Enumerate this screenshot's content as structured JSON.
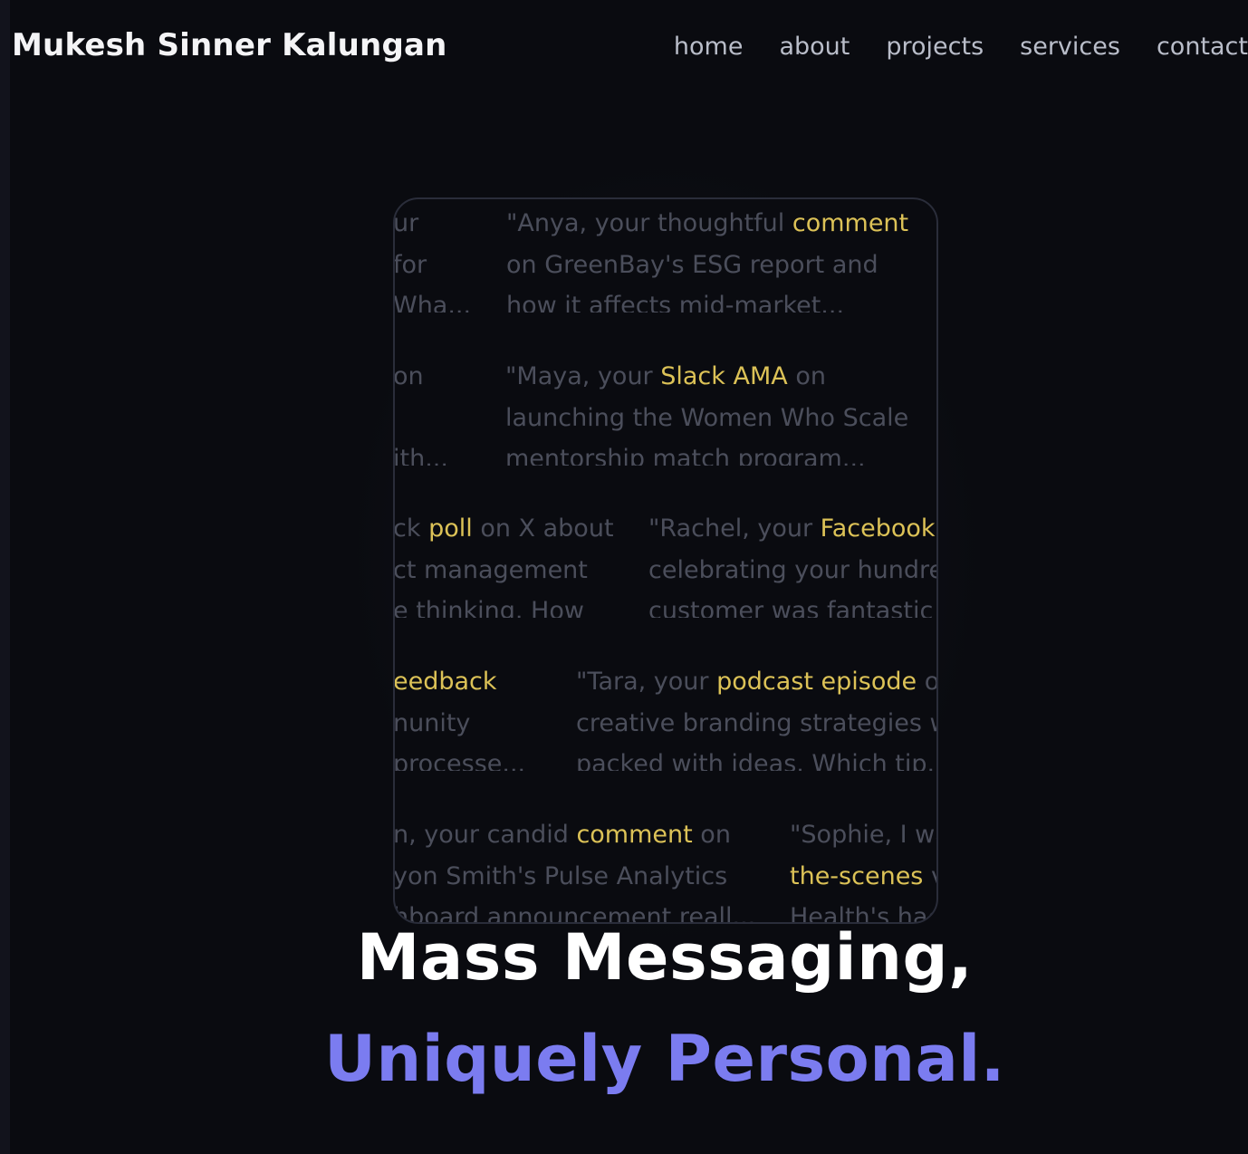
{
  "header": {
    "brand": "Mukesh Sinner Kalungan",
    "nav": [
      {
        "label": "home"
      },
      {
        "label": "about"
      },
      {
        "label": "projects"
      },
      {
        "label": "services"
      },
      {
        "label": "contact"
      }
    ]
  },
  "messages": {
    "m1": {
      "l1": "ur",
      "l2": "for",
      "l3": "Wha..."
    },
    "m2": {
      "l1_pre": "\"Anya, your thoughtful ",
      "l1_hl": "comment",
      "l2": "on GreenBay's ESG report and",
      "l3": "how it affects mid-market..."
    },
    "m3": {
      "l1": "on",
      "l3": "ith..."
    },
    "m4": {
      "l1_pre": "\"Maya, your ",
      "l1_hl": "Slack AMA",
      "l1_post": " on",
      "l2": "launching the Women Who Scale",
      "l3": "mentorship match program..."
    },
    "m5": {
      "l1_pre": "ck ",
      "l1_hl": "poll",
      "l1_post": " on X about",
      "l2": "ct management",
      "l3": "e thinking. How"
    },
    "m6": {
      "l1_pre": "\"Rachel, your ",
      "l1_hl": "Facebook p",
      "l2": "celebrating your hundred",
      "l3": "customer was fantastic"
    },
    "m7": {
      "l1_hl": "eedback",
      "l2": "nunity",
      "l3": "processe..."
    },
    "m8": {
      "l1_pre": "\"Tara, your ",
      "l1_hl": "podcast episode",
      "l1_post": " on",
      "l2": "creative branding strategies wa",
      "l3": "packed with ideas. Which tip..."
    },
    "m9": {
      "l1_pre": "n, your candid ",
      "l1_hl": "comment",
      "l1_post": " on",
      "l2": "yon Smith's Pulse Analytics",
      "l3": "hboard announcement reall..."
    },
    "m10": {
      "l1": "\"Sophie, I wa",
      "l2_hl": "the-scenes",
      "l2_post": " v",
      "l3": "Health's hac"
    }
  },
  "hero": {
    "line1": "Mass Messaging,",
    "line2": "Uniquely Personal."
  },
  "colors": {
    "background": "#0a0b10",
    "muted_text": "#4b4e5b",
    "highlight": "#dcc257",
    "accent": "#7b7cf0"
  }
}
